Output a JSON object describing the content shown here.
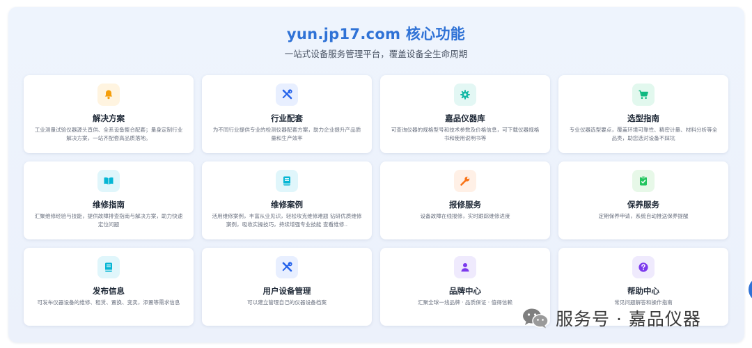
{
  "header": {
    "title": "yun.jp17.com 核心功能",
    "subtitle": "一站式设备服务管理平台，覆盖设备全生命周期"
  },
  "colors": {
    "accent": "#2f72d6",
    "amber": "#f59e0b",
    "blue": "#2563eb",
    "teal": "#14b8a6",
    "green": "#10b981",
    "cyan": "#06b6d4",
    "orange": "#f97316",
    "lime": "#22c55e",
    "purple": "#7c3aed"
  },
  "cards": [
    {
      "title": "解决方案",
      "desc": "工业测量试验仪器源头直供、全系设备整合配套；量身定制行业解决方案，一站齐配套高品质落地。",
      "icon": "bell-icon"
    },
    {
      "title": "行业配套",
      "desc": "为不同行业提供专业的检测仪器配套方案，助力企业提升产品质量和生产效率",
      "icon": "tools-icon"
    },
    {
      "title": "嘉品仪器库",
      "desc": "可查询仪器的规格型号和技术参数及价格信息，可下载仪器规格书和使用说明书等",
      "icon": "gear-icon"
    },
    {
      "title": "选型指南",
      "desc": "专业仪器选型要点，覆盖环境可靠性、精密计量、材料分析等全品类，助您选对设备不踩坑",
      "icon": "cart-icon"
    },
    {
      "title": "维修指南",
      "desc": "汇聚维修经验与技能，提供故障排查指南与解决方案，助力快速定位问题",
      "icon": "open-book-icon"
    },
    {
      "title": "维修案例",
      "desc": "活用维修案例，丰富从业见识，轻松攻克维修难题 钻研优质维修案例，吸收实操技巧，持续增强专业技能 查看维修..",
      "icon": "book-icon"
    },
    {
      "title": "报修服务",
      "desc": "设备故障在线报修，实时跟踪维修进度",
      "icon": "wrench-icon"
    },
    {
      "title": "保养服务",
      "desc": "定期保养申请，系统自动推送保养提醒",
      "icon": "clipboard-check-icon"
    },
    {
      "title": "发布信息",
      "desc": "可发布仪器设备的维修、租赁、置换、变卖，添置等需求信息",
      "icon": "book-icon"
    },
    {
      "title": "用户设备管理",
      "desc": "可以建立管理自己的仪器设备档案",
      "icon": "tools-icon"
    },
    {
      "title": "品牌中心",
      "desc": "汇聚全球一线品牌 · 品质保证 · 值得信赖",
      "icon": "user-icon"
    },
    {
      "title": "帮助中心",
      "desc": "常见问题解答和操作指南",
      "icon": "question-icon"
    }
  ],
  "watermark": {
    "text": "服务号 · 嘉品仪器",
    "icon": "wechat-icon"
  }
}
